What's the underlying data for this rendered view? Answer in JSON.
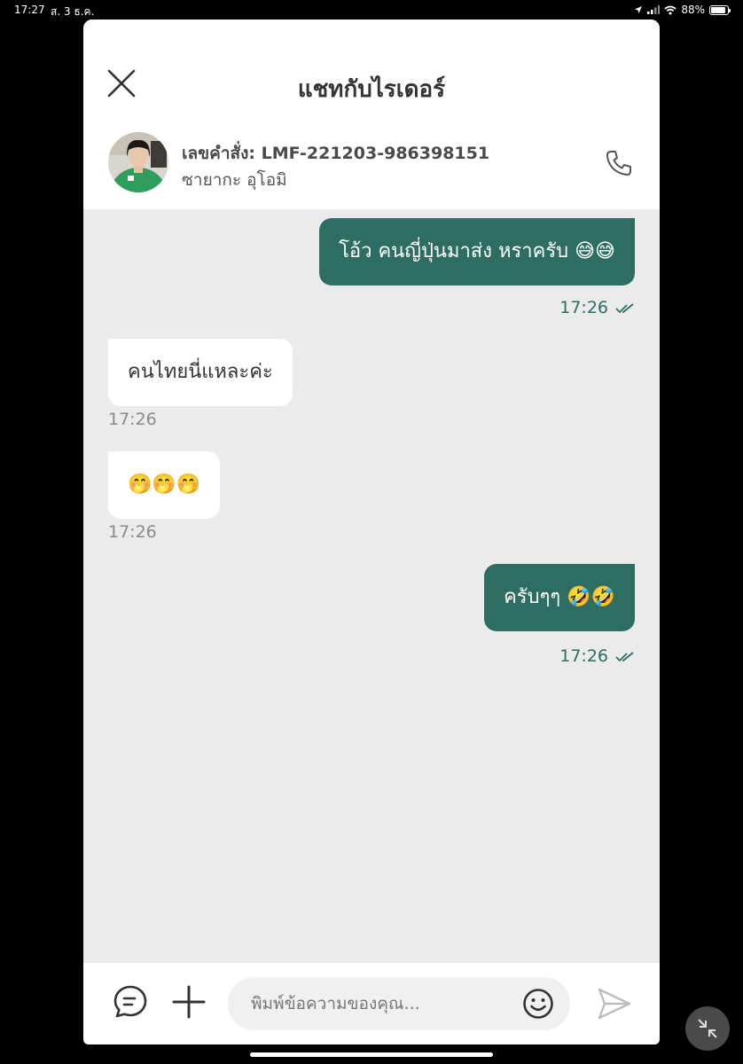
{
  "status_bar": {
    "time": "17:27",
    "date": "ส. 3 ธ.ค.",
    "battery": "88%",
    "battery_level": 0.88
  },
  "header": {
    "title": "แชทกับไรเดอร์",
    "order_label": "เลขคำสั่ง: LMF-221203-986398151",
    "rider_name": "ซายากะ อุโอมิ"
  },
  "messages": [
    {
      "side": "out",
      "text": "โอ้ว คนญี่ปุ่นมาส่ง หราครับ 😅😅",
      "time": "17:26"
    },
    {
      "side": "in",
      "text": "คนไทยนี่แหละค่ะ",
      "time": "17:26"
    },
    {
      "side": "in",
      "text": "🤭🤭🤭",
      "time": "17:26"
    },
    {
      "side": "out",
      "text": "ครับๆๆ 🤣🤣",
      "time": "17:26"
    }
  ],
  "composer": {
    "placeholder": "พิมพ์ข้อความของคุณ..."
  },
  "colors": {
    "accent": "#2e6e62",
    "chat_background": "#ebebeb"
  }
}
